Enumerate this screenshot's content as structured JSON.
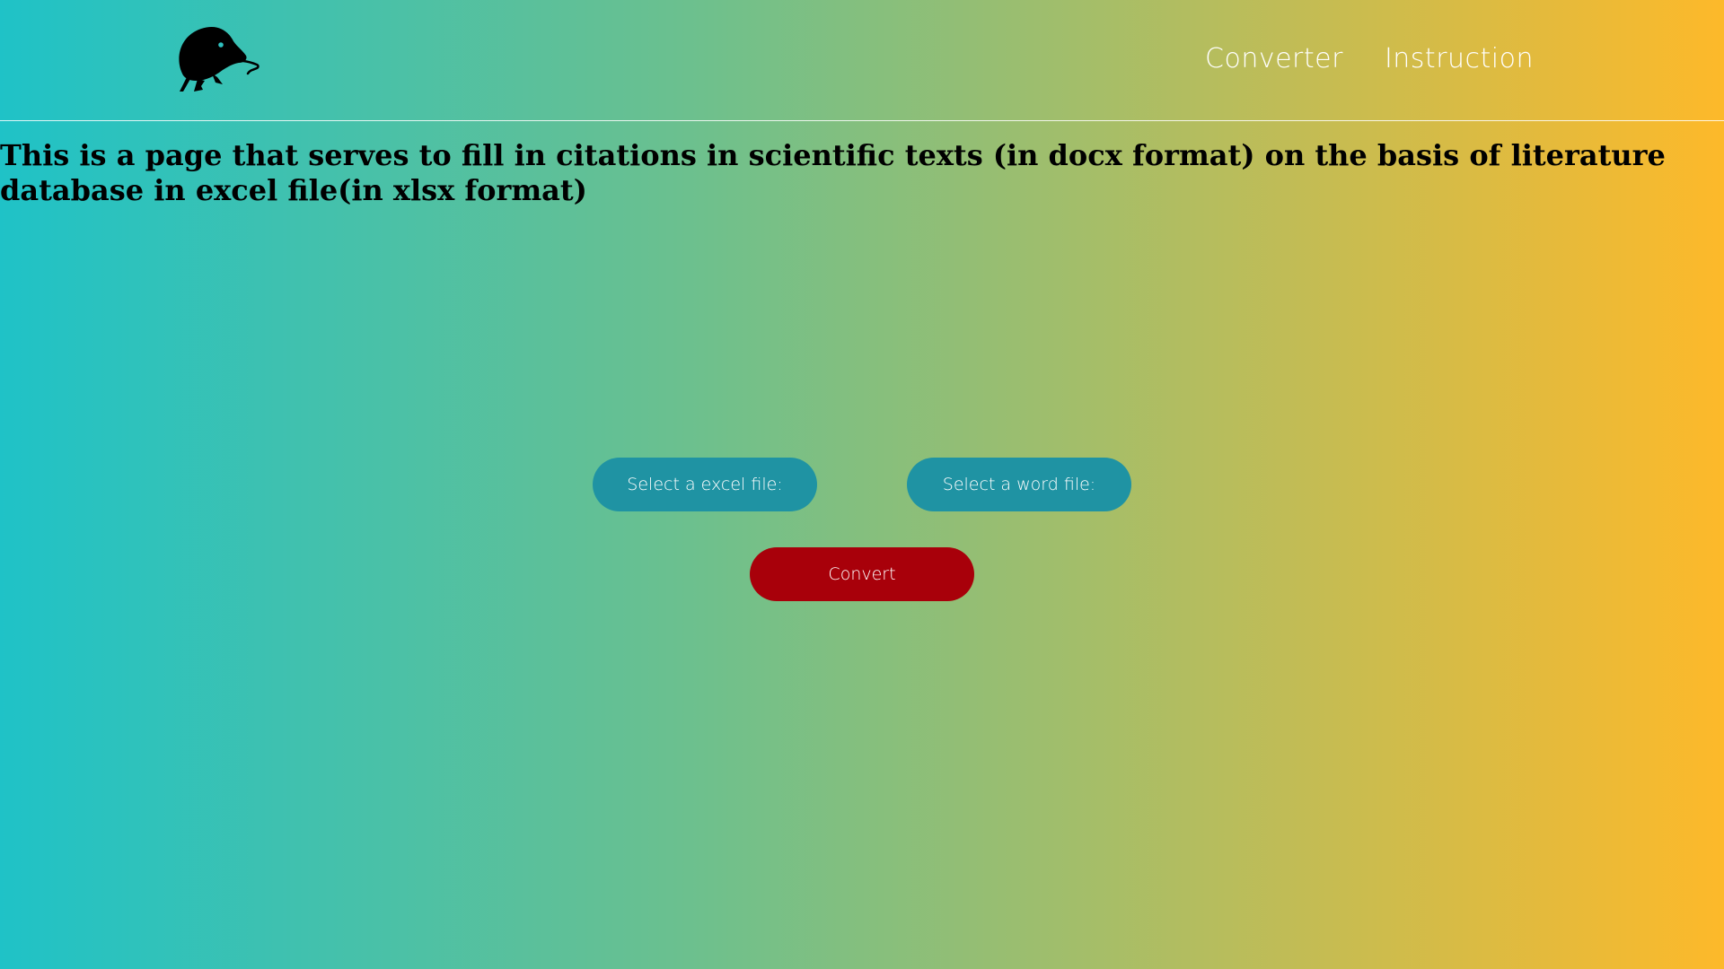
{
  "header": {
    "logo_icon": "rodent-logo-icon",
    "nav": [
      {
        "label": "Converter"
      },
      {
        "label": "Instruction"
      }
    ]
  },
  "main": {
    "headline": "This is a page that serves to fill in citations in scientific texts (in docx format) on the basis of literature database in excel file(in xlsx format)",
    "excel_button_label": "Select a excel file:",
    "word_button_label": "Select a word file:",
    "convert_button_label": "Convert"
  },
  "colors": {
    "gradient_start": "#1fc2c7",
    "gradient_end": "#fdb92a",
    "file_button": "#1f93a3",
    "convert_button": "#a8000a"
  }
}
